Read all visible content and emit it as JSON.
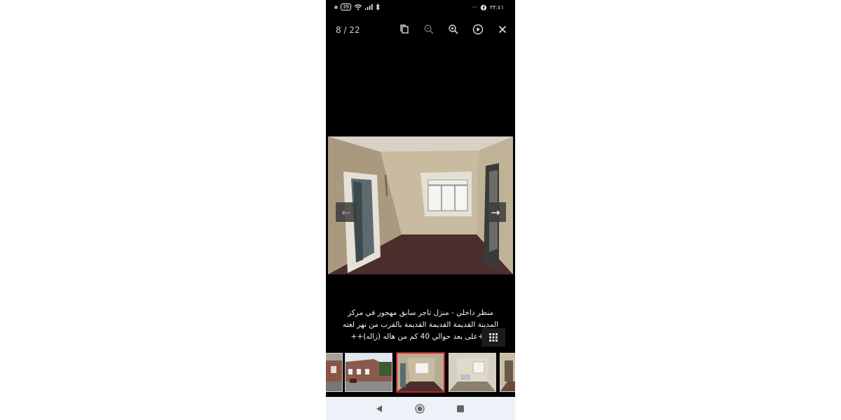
{
  "status_bar": {
    "battery": "39",
    "time": "٢٢:٤١",
    "overflow": "···"
  },
  "viewer": {
    "counter": "8 / 22",
    "icons": [
      "copy-icon",
      "zoom-out-icon",
      "zoom-in-icon",
      "play-icon",
      "close-icon"
    ],
    "caption_lines": [
      "منظر داخلي - منزل تاجر سابق مهجور في مركز",
      "المدينة القديمة القديمة القديمة بالقرب من نهر لغته",
      "++على بعد حوالي 40 كم من هاله (زاله)++"
    ]
  },
  "navigation": {
    "prev_arrow": "←",
    "next_arrow": "→"
  },
  "thumbnails": [
    {
      "label": "thumb-1",
      "active": false
    },
    {
      "label": "thumb-2",
      "active": false
    },
    {
      "label": "thumb-3",
      "active": true
    },
    {
      "label": "thumb-4",
      "active": false
    },
    {
      "label": "thumb-5",
      "active": false
    }
  ],
  "colors": {
    "background": "#000000",
    "active_thumb_border": "#c0202a",
    "navbar": "#eef1f7"
  }
}
